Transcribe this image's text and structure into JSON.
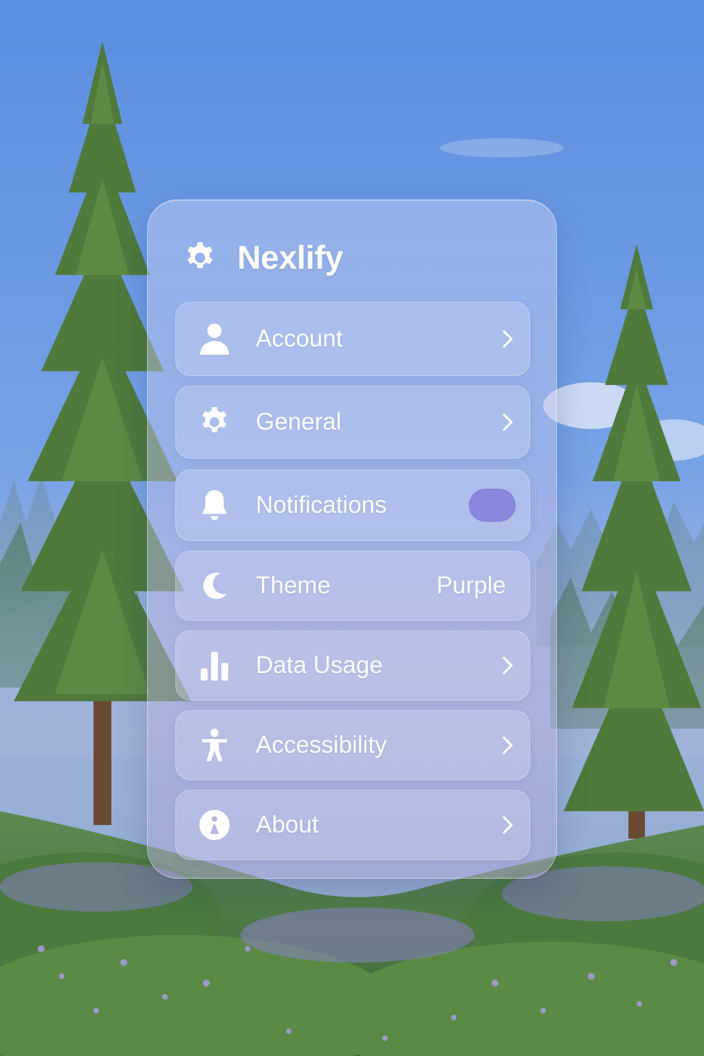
{
  "app": {
    "title": "Nexlify",
    "brand_icon": "gear-icon"
  },
  "colors": {
    "accent": "#8b88e0",
    "text": "#ffffff"
  },
  "settings": {
    "items": [
      {
        "label": "Account",
        "icon": "person-icon",
        "control": "chevron"
      },
      {
        "label": "General",
        "icon": "gear-icon",
        "control": "chevron"
      },
      {
        "label": "Notifications",
        "icon": "bell-icon",
        "control": "toggle",
        "toggle_on": true
      },
      {
        "label": "Theme",
        "icon": "moon-icon",
        "control": "value",
        "value": "Purple"
      },
      {
        "label": "Data Usage",
        "icon": "bar-chart-icon",
        "control": "chevron"
      },
      {
        "label": "Accessibility",
        "icon": "accessibility-icon",
        "control": "chevron"
      },
      {
        "label": "About",
        "icon": "info-icon",
        "control": "chevron"
      }
    ]
  }
}
